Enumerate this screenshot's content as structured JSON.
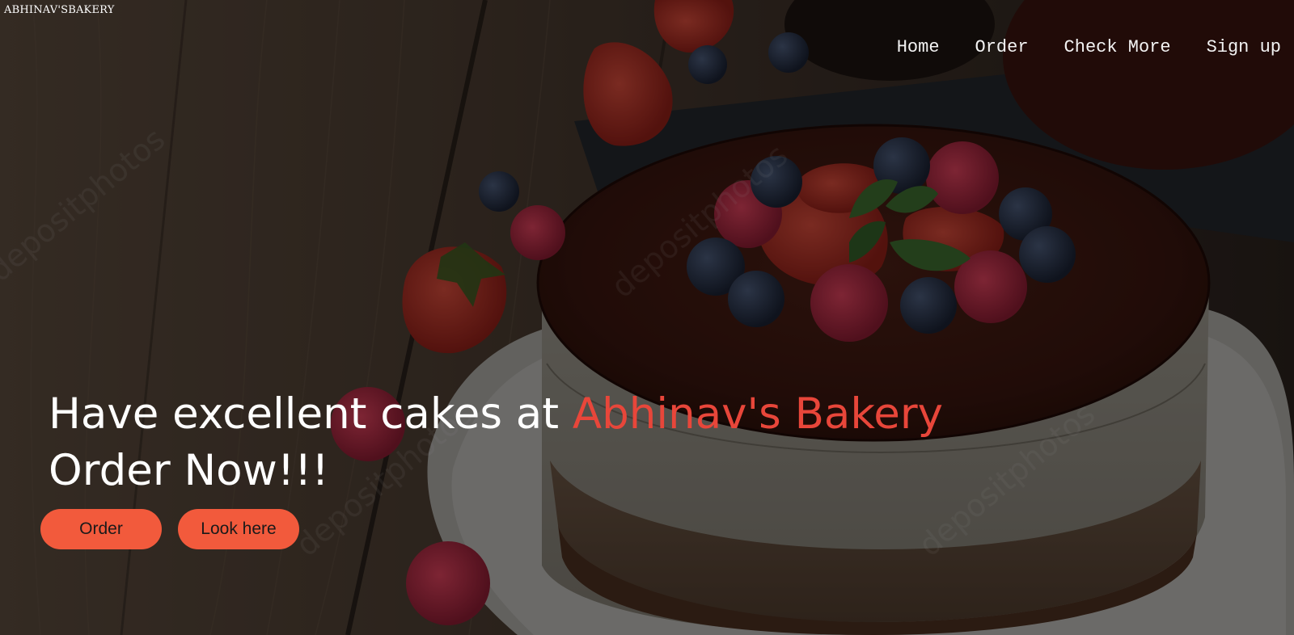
{
  "brand": {
    "name": "ABHINAV'SBAKERY"
  },
  "nav": {
    "items": [
      {
        "label": "Home"
      },
      {
        "label": "Order"
      },
      {
        "label": "Check More"
      },
      {
        "label": "Sign up"
      }
    ]
  },
  "hero": {
    "headline_lead": "Have excellent cakes at ",
    "headline_accent": "Abhinav's Bakery",
    "headline_line2": "Order Now!!!",
    "watermark": "depositphotos",
    "buttons": {
      "order_label": "Order",
      "look_label": "Look here"
    }
  },
  "colors": {
    "accent": "#e8463a",
    "button": "#f25a3c",
    "overlay": "#000000"
  }
}
